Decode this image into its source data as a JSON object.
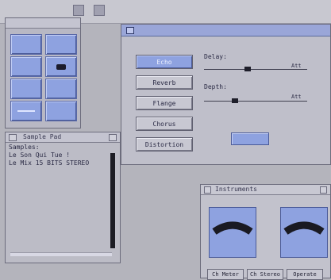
{
  "screen": {
    "title": ""
  },
  "palette": {
    "title": "",
    "tiles": [
      "",
      "",
      "",
      "",
      "",
      "",
      "",
      ""
    ]
  },
  "sample_pad": {
    "title": "Sample Pad",
    "header": "Samples:",
    "items": [
      "Le Son Qui Tue !",
      "Le Mix 15 BITS STEREO"
    ]
  },
  "effects": {
    "title": "",
    "buttons": [
      "Echo",
      "Reverb",
      "Flange",
      "Chorus",
      "Distortion"
    ],
    "active": "Echo",
    "delay": {
      "label": "Delay:",
      "end": "Att",
      "level": 0.42
    },
    "depth": {
      "label": "Depth:",
      "end": "Att",
      "level": 0.3
    },
    "action_label": ""
  },
  "instruments": {
    "title": "Instruments",
    "buttons": [
      "Ch Meter",
      "Ch Stereo",
      "Operate"
    ]
  },
  "colors": {
    "accent": "#8ea2e0",
    "window_bg": "#bfbfca",
    "desktop": "#b4b4bc"
  }
}
